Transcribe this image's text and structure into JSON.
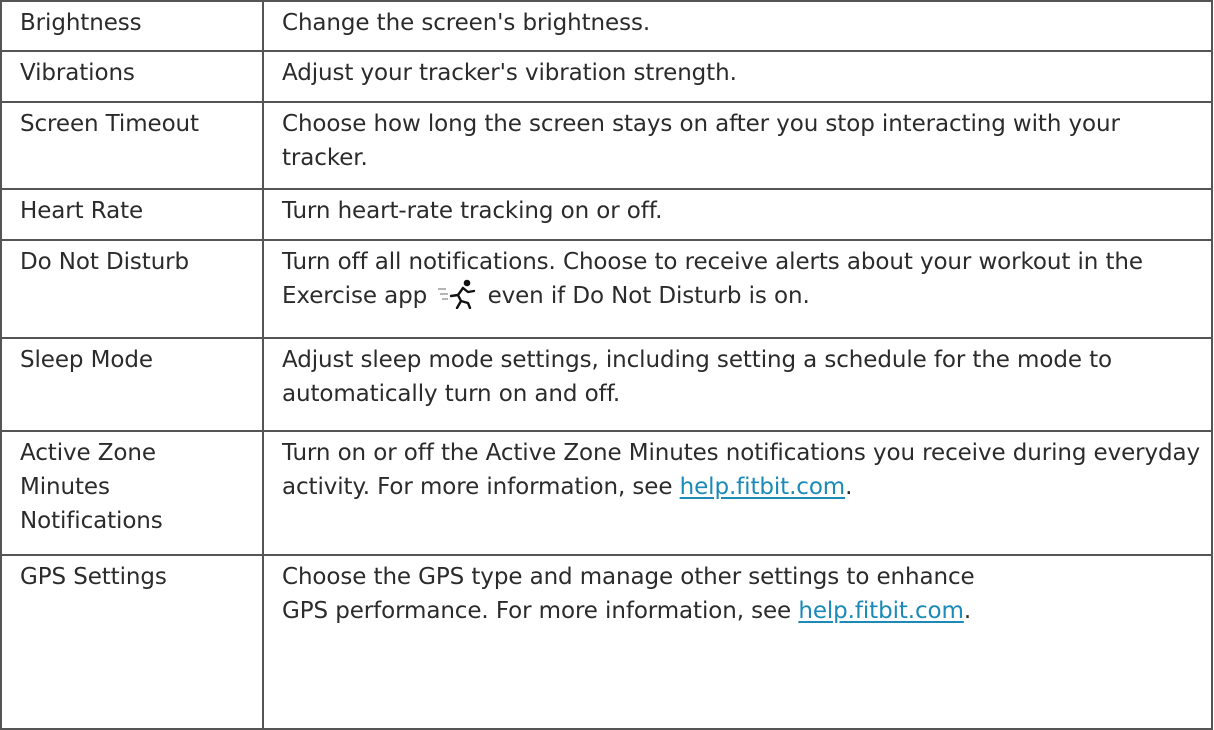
{
  "rows": [
    {
      "name": "Brightness",
      "desc": "Change the screen's brightness."
    },
    {
      "name": "Vibrations",
      "desc": "Adjust your tracker's vibration strength."
    },
    {
      "name": "Screen Timeout",
      "desc": "Choose how long the screen stays on after you stop interacting with your tracker."
    },
    {
      "name": "Heart Rate",
      "desc": "Turn heart-rate tracking on or off."
    },
    {
      "name": "Do Not Disturb",
      "desc_before": "Turn off all notifications. Choose to receive alerts about your workout in the Exercise app",
      "desc_after": "even if Do Not Disturb is on.",
      "icon": "exercise-runner-icon"
    },
    {
      "name": "Sleep Mode",
      "desc": "Adjust sleep mode settings, including setting a schedule for the mode to automatically turn on and off."
    },
    {
      "name_lines": [
        "Active Zone",
        "Minutes",
        "Notifications"
      ],
      "desc_before": "Turn on or off the Active Zone Minutes notifications you receive during everyday activity. For more information, see",
      "link": "help.fitbit.com",
      "desc_after": "."
    },
    {
      "name": "GPS Settings",
      "desc_line1": "Choose the GPS type and manage other settings to enhance",
      "desc_before": "GPS performance. For more information, see",
      "link": "help.fitbit.com",
      "desc_after": "."
    }
  ],
  "colors": {
    "text": "#2b2b2b",
    "border": "#555555",
    "link": "#1b8ab8"
  }
}
